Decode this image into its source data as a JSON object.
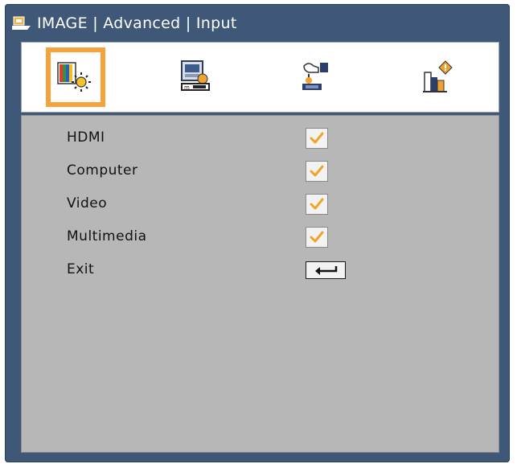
{
  "header": {
    "title": "IMAGE | Advanced | Input",
    "icon": "menu-folder-icon"
  },
  "tabs": [
    {
      "name": "image-tab",
      "icon": "image-brightness-icon",
      "selected": true
    },
    {
      "name": "display-tab",
      "icon": "display-screen-icon",
      "selected": false
    },
    {
      "name": "setup-tab",
      "icon": "setup-hand-icon",
      "selected": false
    },
    {
      "name": "options-tab",
      "icon": "options-info-icon",
      "selected": false
    }
  ],
  "menu": {
    "items": [
      {
        "label": "HDMI",
        "checked": true
      },
      {
        "label": "Computer",
        "checked": true
      },
      {
        "label": "Video",
        "checked": true
      },
      {
        "label": "Multimedia",
        "checked": true
      },
      {
        "label": "Exit",
        "control": "enter-key-icon"
      }
    ]
  },
  "colors": {
    "frame": "#3f5878",
    "selected_tab": "#f5a23a",
    "content_bg": "#b7b7b7",
    "check_mark": "#f0a42b"
  }
}
